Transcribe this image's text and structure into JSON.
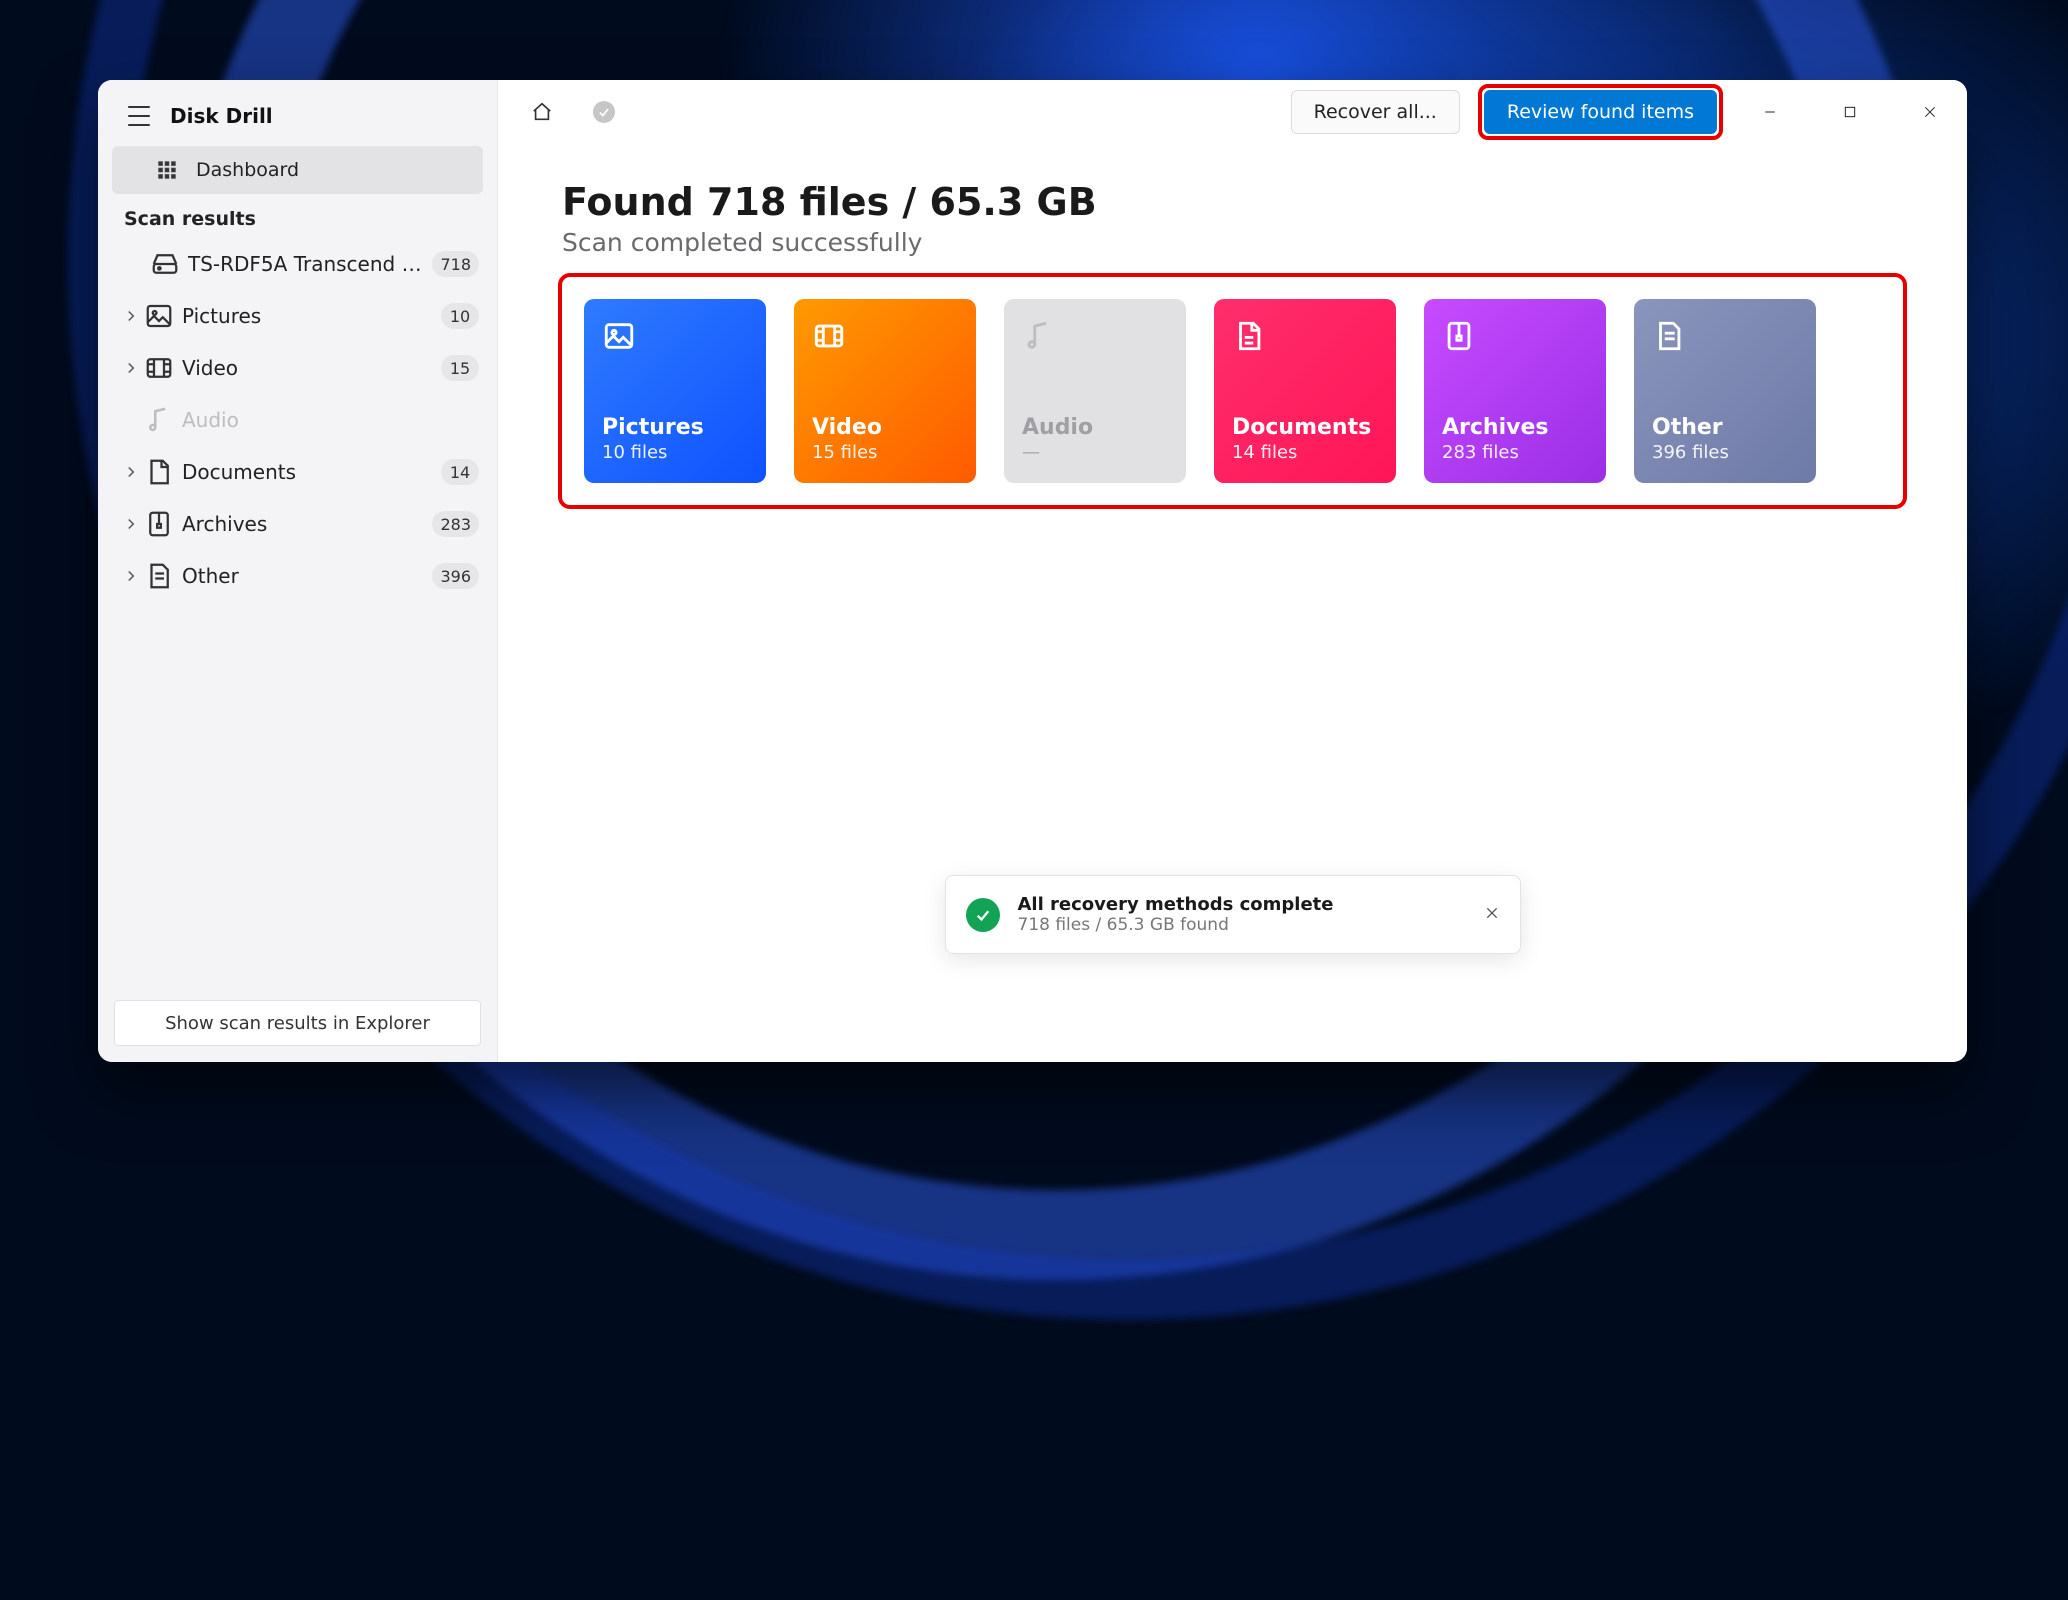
{
  "app": {
    "title": "Disk Drill"
  },
  "sidebar": {
    "dashboard_label": "Dashboard",
    "section_label": "Scan results",
    "drive_item": {
      "label": "TS-RDF5A Transcend US...",
      "badge": "718"
    },
    "items": [
      {
        "label": "Pictures",
        "badge": "10"
      },
      {
        "label": "Video",
        "badge": "15"
      },
      {
        "label": "Audio",
        "badge": ""
      },
      {
        "label": "Documents",
        "badge": "14"
      },
      {
        "label": "Archives",
        "badge": "283"
      },
      {
        "label": "Other",
        "badge": "396"
      }
    ],
    "footer_button": "Show scan results in Explorer"
  },
  "titlebar": {
    "recover_label": "Recover all...",
    "review_label": "Review found items"
  },
  "results": {
    "headline": "Found 718 files / 65.3 GB",
    "subline": "Scan completed successfully",
    "cards": {
      "pictures": {
        "title": "Pictures",
        "sub": "10 files"
      },
      "video": {
        "title": "Video",
        "sub": "15 files"
      },
      "audio": {
        "title": "Audio",
        "sub": "—"
      },
      "documents": {
        "title": "Documents",
        "sub": "14 files"
      },
      "archives": {
        "title": "Archives",
        "sub": "283 files"
      },
      "other": {
        "title": "Other",
        "sub": "396 files"
      }
    }
  },
  "toast": {
    "title": "All recovery methods complete",
    "sub": "718 files / 65.3 GB found"
  }
}
